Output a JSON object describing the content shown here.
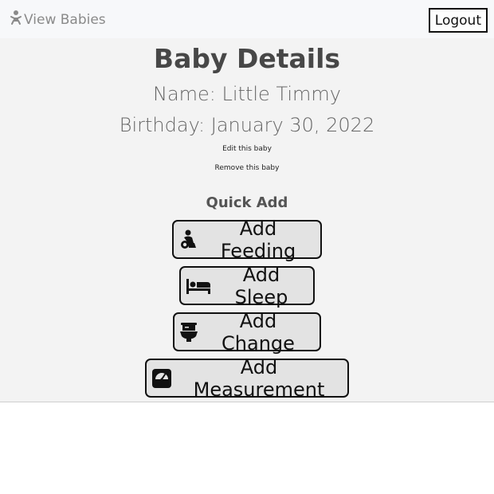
{
  "nav": {
    "brand_label": "View Babies",
    "brand_icon": "baby-icon",
    "logout_label": "Logout"
  },
  "details": {
    "title": "Baby Details",
    "name_line": "Name: Little Timmy",
    "birthday_line": "Birthday: January 30, 2022",
    "edit_link": "Edit this baby",
    "remove_link": "Remove this baby"
  },
  "quick_add": {
    "title": "Quick Add",
    "buttons": [
      {
        "label": "Add Feeding",
        "icon": "feeding-icon"
      },
      {
        "label": "Add Sleep",
        "icon": "bed-icon"
      },
      {
        "label": "Add Change",
        "icon": "toilet-icon"
      },
      {
        "label": "Add Measurement",
        "icon": "scale-icon"
      }
    ]
  },
  "colors": {
    "nav_background": "#f7f8fa",
    "main_background": "#f3f3f3",
    "button_background": "#e3e3e3",
    "border": "#111111"
  }
}
